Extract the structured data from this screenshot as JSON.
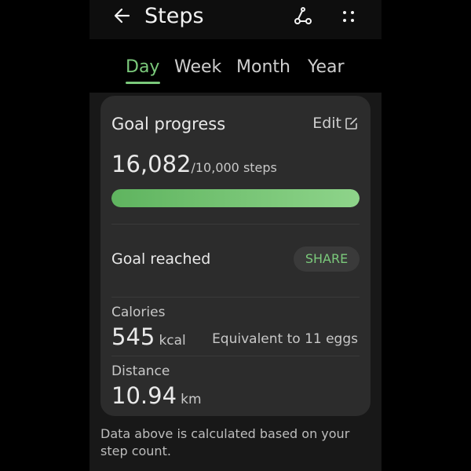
{
  "header": {
    "title": "Steps",
    "back_icon": "back-arrow-icon",
    "route_icon": "route-share-icon",
    "more_icon": "more-options-icon"
  },
  "tabs": [
    {
      "label": "Day",
      "active": true
    },
    {
      "label": "Week",
      "active": false
    },
    {
      "label": "Month",
      "active": false
    },
    {
      "label": "Year",
      "active": false
    }
  ],
  "goal_card": {
    "title": "Goal progress",
    "edit_label": "Edit",
    "edit_icon": "edit-icon",
    "steps_value": "16,082",
    "steps_target": "/10,000 steps",
    "progress_fraction": 1.0,
    "goal_reached_label": "Goal reached",
    "share_label": "SHARE",
    "calories_label": "Calories",
    "calories_value": "545",
    "calories_unit": "kcal",
    "calories_equivalent": "Equivalent to 11 eggs",
    "distance_label": "Distance",
    "distance_value": "10.94",
    "distance_unit": "km"
  },
  "footnote": "Data above is calculated based on your step count.",
  "colors": {
    "accent": "#7bc97b",
    "card_bg": "#2c2c2c",
    "page_bg": "#000000"
  }
}
